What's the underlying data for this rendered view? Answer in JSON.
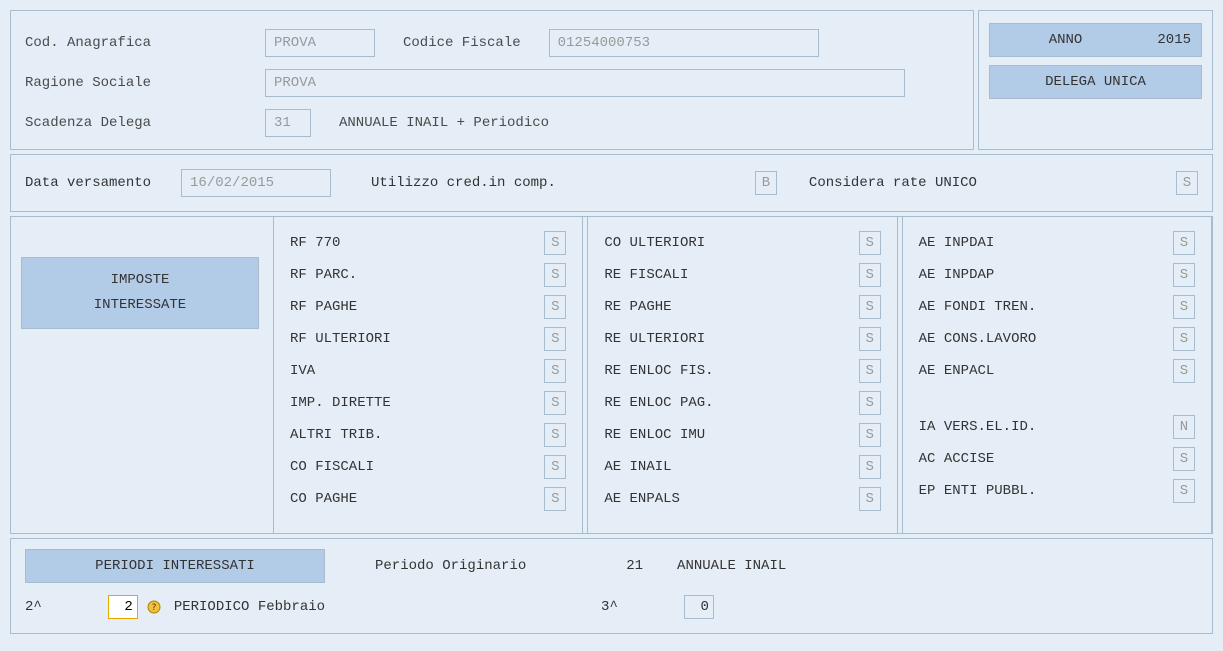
{
  "header": {
    "cod_anag_label": "Cod. Anagrafica",
    "cod_anag_value": "PROVA",
    "cod_fisc_label": "Codice Fiscale",
    "cod_fisc_value": "01254000753",
    "ragione_label": "Ragione Sociale",
    "ragione_value": "PROVA",
    "scad_label": "Scadenza Delega",
    "scad_value": "31",
    "scad_desc": "ANNUALE INAIL + Periodico",
    "anno_label": "ANNO",
    "anno_value": "2015",
    "delega_label": "DELEGA UNICA"
  },
  "row2": {
    "data_vers_label": "Data versamento",
    "data_vers_value": "16/02/2015",
    "utilizzo_label": "Utilizzo cred.in comp.",
    "utilizzo_value": "B",
    "considera_label": "Considera rate UNICO",
    "considera_value": "S"
  },
  "imposte": {
    "title1": "IMPOSTE",
    "title2": "INTERESSATE",
    "col1": [
      {
        "label": "RF 770",
        "v": "S"
      },
      {
        "label": "RF PARC.",
        "v": "S"
      },
      {
        "label": "RF PAGHE",
        "v": "S"
      },
      {
        "label": "RF ULTERIORI",
        "v": "S"
      },
      {
        "label": "IVA",
        "v": "S"
      },
      {
        "label": "IMP. DIRETTE",
        "v": "S"
      },
      {
        "label": "ALTRI TRIB.",
        "v": "S"
      },
      {
        "label": "CO FISCALI",
        "v": "S"
      },
      {
        "label": "CO PAGHE",
        "v": "S"
      }
    ],
    "col2": [
      {
        "label": "CO ULTERIORI",
        "v": "S"
      },
      {
        "label": "RE FISCALI",
        "v": "S"
      },
      {
        "label": "RE PAGHE",
        "v": "S"
      },
      {
        "label": "RE ULTERIORI",
        "v": "S"
      },
      {
        "label": "RE ENLOC FIS.",
        "v": "S"
      },
      {
        "label": "RE ENLOC PAG.",
        "v": "S"
      },
      {
        "label": "RE ENLOC IMU",
        "v": "S"
      },
      {
        "label": "AE INAIL",
        "v": "S"
      },
      {
        "label": "AE ENPALS",
        "v": "S"
      }
    ],
    "col3a": [
      {
        "label": "AE INPDAI",
        "v": "S"
      },
      {
        "label": "AE INPDAP",
        "v": "S"
      },
      {
        "label": "AE FONDI TREN.",
        "v": "S"
      },
      {
        "label": "AE CONS.LAVORO",
        "v": "S"
      },
      {
        "label": "AE ENPACL",
        "v": "S"
      }
    ],
    "col3b": [
      {
        "label": "IA VERS.EL.ID.",
        "v": "N"
      },
      {
        "label": "AC ACCISE",
        "v": "S"
      },
      {
        "label": "EP ENTI PUBBL.",
        "v": "S"
      }
    ]
  },
  "periodi": {
    "title": "PERIODI INTERESSATI",
    "orig_label": "Periodo Originario",
    "orig_value": "21",
    "orig_desc": "ANNUALE INAIL",
    "p2_label": "2^",
    "p2_value": "2",
    "p2_desc": "PERIODICO Febbraio",
    "p3_label": "3^",
    "p3_value": "0"
  }
}
